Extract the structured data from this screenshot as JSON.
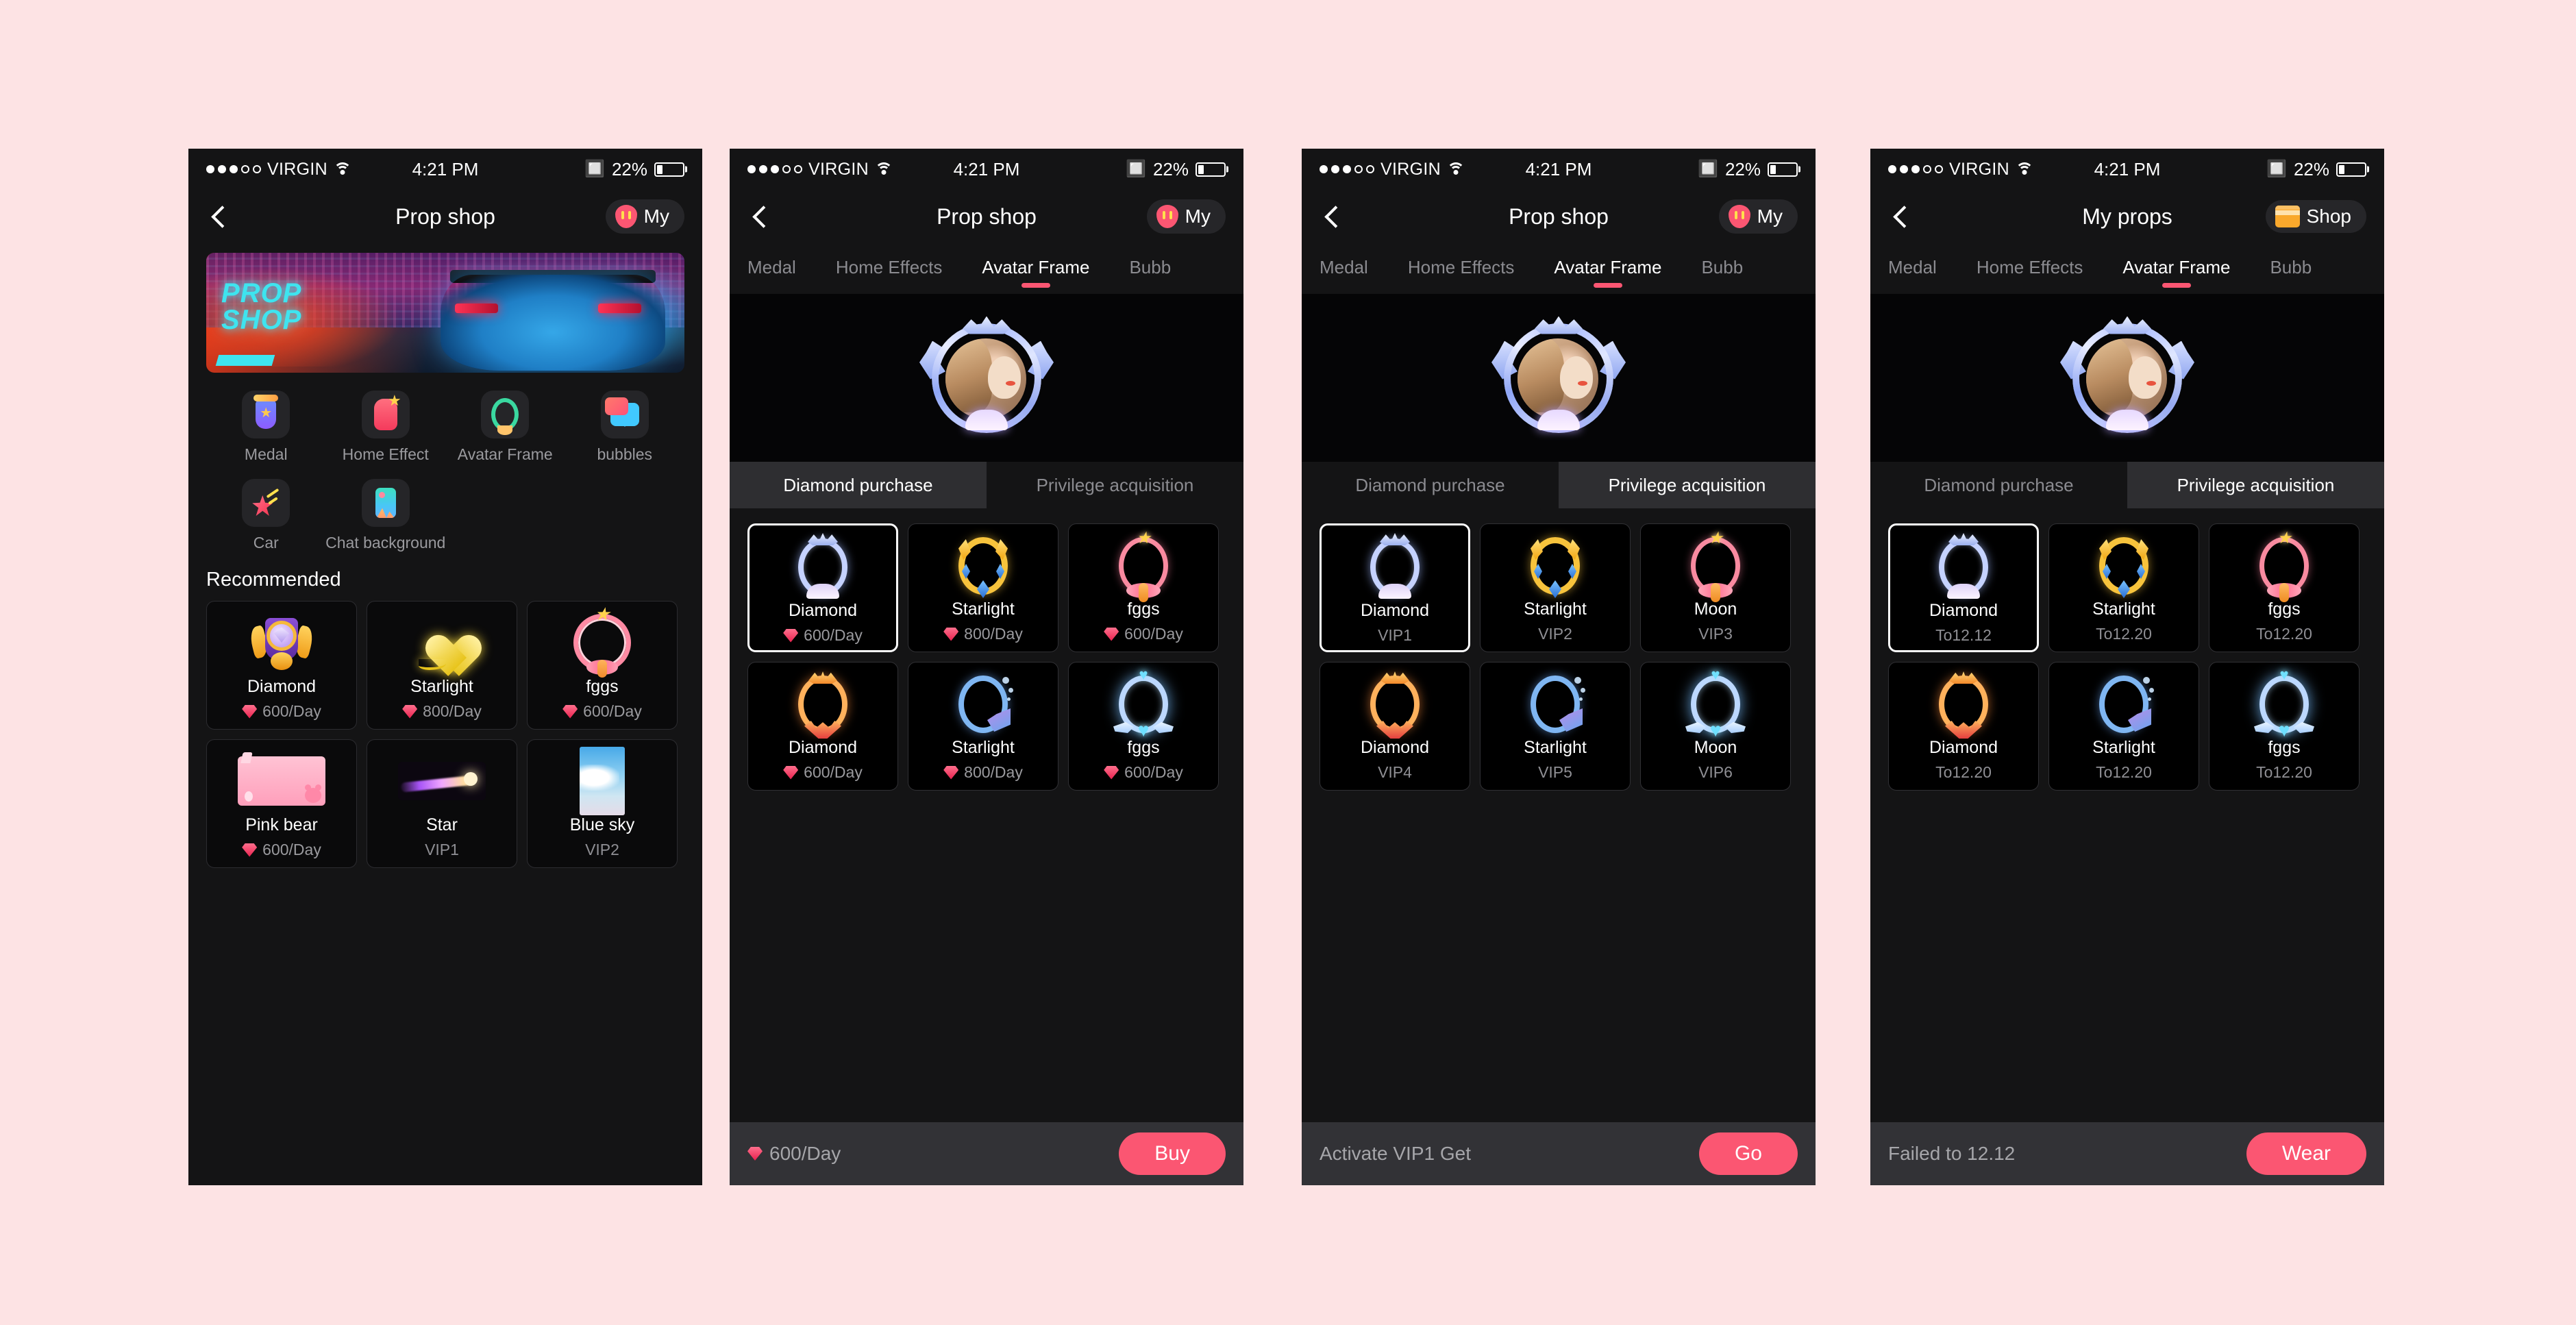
{
  "status_bar": {
    "carrier": "VIRGIN",
    "time": "4:21 PM",
    "battery_percent": "22%",
    "signal_dots_filled": 3,
    "signal_dots_total": 5
  },
  "colors": {
    "page_background": "#fde3e4",
    "screen_background": "#141415",
    "accent_pink": "#fb5672",
    "card_background": "#000000",
    "muted_text": "#9a9a9e",
    "bottom_bar": "#323236"
  },
  "panel1": {
    "nav": {
      "title": "Prop shop",
      "back_icon": "chevron-left-icon",
      "pill_label": "My",
      "pill_icon": "my-token-icon"
    },
    "banner": {
      "line1": "PROP",
      "line2": "SHOP"
    },
    "categories": [
      {
        "label": "Medal",
        "icon": "medal-icon"
      },
      {
        "label": "Home Effect",
        "icon": "home-effect-icon"
      },
      {
        "label": "Avatar Frame",
        "icon": "avatar-frame-icon"
      },
      {
        "label": "bubbles",
        "icon": "bubbles-icon"
      },
      {
        "label": "Car",
        "icon": "car-icon"
      },
      {
        "label": "Chat background",
        "icon": "chat-background-icon"
      }
    ],
    "section_title": "Recommended",
    "recommended": [
      {
        "name": "Diamond",
        "price": "600/Day",
        "type": "price",
        "art": "medal-badge"
      },
      {
        "name": "Starlight",
        "price": "800/Day",
        "type": "price",
        "art": "gold-heart"
      },
      {
        "name": "fggs",
        "price": "600/Day",
        "type": "price",
        "art": "pink-ring"
      },
      {
        "name": "Pink bear",
        "price": "600/Day",
        "type": "price",
        "art": "pink-bear-chat"
      },
      {
        "name": "Star",
        "price": "VIP1",
        "type": "vip",
        "art": "star-trail"
      },
      {
        "name": "Blue sky",
        "price": "VIP2",
        "type": "vip",
        "art": "blue-sky"
      }
    ]
  },
  "panel2": {
    "nav": {
      "title": "Prop shop",
      "back_icon": "chevron-left-icon",
      "pill_label": "My",
      "pill_icon": "my-token-icon"
    },
    "tabs": [
      {
        "label": "Medal",
        "active": false
      },
      {
        "label": "Home Effects",
        "active": false
      },
      {
        "label": "Avatar Frame",
        "active": true
      },
      {
        "label": "Bubb",
        "active": false
      }
    ],
    "subtabs": [
      {
        "label": "Diamond purchase",
        "active": true
      },
      {
        "label": "Privilege acquisition",
        "active": false
      }
    ],
    "items": [
      {
        "name": "Diamond",
        "meta": "600/Day",
        "type": "price",
        "art": "ring-diamond",
        "selected": true
      },
      {
        "name": "Starlight",
        "meta": "800/Day",
        "type": "price",
        "art": "ring-gold",
        "selected": false
      },
      {
        "name": "fggs",
        "meta": "600/Day",
        "type": "price",
        "art": "ring-pink",
        "selected": false
      },
      {
        "name": "Diamond",
        "meta": "600/Day",
        "type": "price",
        "art": "ring-fire",
        "selected": false
      },
      {
        "name": "Starlight",
        "meta": "800/Day",
        "type": "price",
        "art": "ring-blue",
        "selected": false
      },
      {
        "name": "fggs",
        "meta": "600/Day",
        "type": "price",
        "art": "ring-ice",
        "selected": false
      }
    ],
    "bottom": {
      "info": "600/Day",
      "info_type": "price",
      "button": "Buy"
    }
  },
  "panel3": {
    "nav": {
      "title": "Prop shop",
      "back_icon": "chevron-left-icon",
      "pill_label": "My",
      "pill_icon": "my-token-icon"
    },
    "tabs": [
      {
        "label": "Medal",
        "active": false
      },
      {
        "label": "Home Effects",
        "active": false
      },
      {
        "label": "Avatar Frame",
        "active": true
      },
      {
        "label": "Bubb",
        "active": false
      }
    ],
    "subtabs": [
      {
        "label": "Diamond purchase",
        "active": false
      },
      {
        "label": "Privilege acquisition",
        "active": true
      }
    ],
    "items": [
      {
        "name": "Diamond",
        "meta": "VIP1",
        "type": "vip",
        "art": "ring-diamond",
        "selected": true
      },
      {
        "name": "Starlight",
        "meta": "VIP2",
        "type": "vip",
        "art": "ring-gold",
        "selected": false
      },
      {
        "name": "Moon",
        "meta": "VIP3",
        "type": "vip",
        "art": "ring-pink",
        "selected": false
      },
      {
        "name": "Diamond",
        "meta": "VIP4",
        "type": "vip",
        "art": "ring-fire",
        "selected": false
      },
      {
        "name": "Starlight",
        "meta": "VIP5",
        "type": "vip",
        "art": "ring-blue",
        "selected": false
      },
      {
        "name": "Moon",
        "meta": "VIP6",
        "type": "vip",
        "art": "ring-ice",
        "selected": false
      }
    ],
    "bottom": {
      "info": "Activate VIP1 Get",
      "info_type": "text",
      "button": "Go"
    }
  },
  "panel4": {
    "nav": {
      "title": "My props",
      "back_icon": "chevron-left-icon",
      "pill_label": "Shop",
      "pill_icon": "shop-icon"
    },
    "tabs": [
      {
        "label": "Medal",
        "active": false
      },
      {
        "label": "Home Effects",
        "active": false
      },
      {
        "label": "Avatar Frame",
        "active": true
      },
      {
        "label": "Bubb",
        "active": false
      }
    ],
    "subtabs": [
      {
        "label": "Diamond purchase",
        "active": false
      },
      {
        "label": "Privilege acquisition",
        "active": true
      }
    ],
    "items": [
      {
        "name": "Diamond",
        "meta": "To12.12",
        "type": "date",
        "art": "ring-diamond",
        "selected": true
      },
      {
        "name": "Starlight",
        "meta": "To12.20",
        "type": "date",
        "art": "ring-gold",
        "selected": false
      },
      {
        "name": "fggs",
        "meta": "To12.20",
        "type": "date",
        "art": "ring-pink",
        "selected": false
      },
      {
        "name": "Diamond",
        "meta": "To12.20",
        "type": "date",
        "art": "ring-fire",
        "selected": false
      },
      {
        "name": "Starlight",
        "meta": "To12.20",
        "type": "date",
        "art": "ring-blue",
        "selected": false
      },
      {
        "name": "fggs",
        "meta": "To12.20",
        "type": "date",
        "art": "ring-ice",
        "selected": false
      }
    ],
    "bottom": {
      "info": "Failed to 12.12",
      "info_type": "text",
      "button": "Wear"
    }
  }
}
